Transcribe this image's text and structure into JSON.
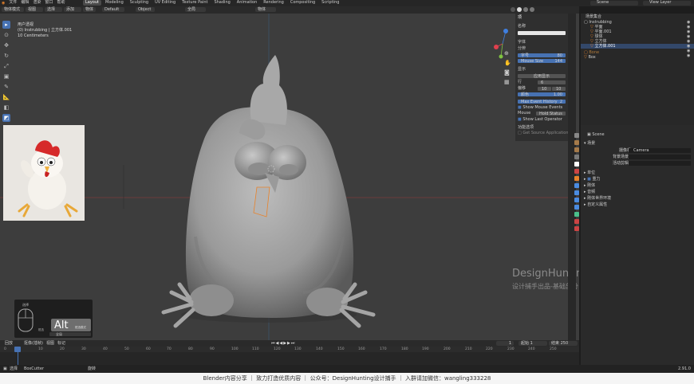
{
  "topbar": {
    "menu": [
      "文件",
      "编辑",
      "渲染",
      "窗口",
      "帮助"
    ],
    "workspaces": [
      "Layout",
      "Modeling",
      "Sculpting",
      "UV Editing",
      "Texture Paint",
      "Shading",
      "Animation",
      "Rendering",
      "Compositing",
      "Scripting"
    ],
    "active_workspace": "Layout",
    "scene": "Scene",
    "view_layer": "View Layer"
  },
  "viewport_header": {
    "mode": "物体模式",
    "view": "视图",
    "select": "选择",
    "add": "添加",
    "object": "物体",
    "orientation": "全局",
    "pivot": "Default",
    "drag": "Object",
    "snap": "全局",
    "shading": "物体"
  },
  "viewport": {
    "view_name": "用户透视",
    "collection_info": "(0) Instrubbing | 立方体.001",
    "subinfo": "10 Centimeters",
    "watermark_title": "DesignHunting",
    "watermark_sub": "设计捕手出品-基础部分",
    "alt_key": "Alt",
    "keypanel_items": [
      "选择",
      "框选模式",
      "框选"
    ],
    "keypanel_dropdown": "全局"
  },
  "npanel": {
    "tab": "项",
    "name_label": "名称",
    "rows": [
      {
        "label": "字体",
        "value": ""
      },
      {
        "label": "分辨",
        "value": ""
      },
      {
        "label": "字号",
        "value": "80"
      },
      {
        "label": "Mouse Size",
        "value": "144"
      }
    ],
    "section_label": "显示",
    "apply_button": "应用显示",
    "lines_label": "行",
    "lines_value": "6",
    "offset_label": "偏移",
    "offset_x": "10",
    "offset_y": "10",
    "color_label": "颜色",
    "color_value": "1.00",
    "history": "Max Event History",
    "history_value": "2",
    "mouse_events": "Show Mouse Events",
    "mouse_label": "Mouse",
    "mouse_value": "Hold Status",
    "last_op": "Show Last Operator",
    "extra_label": "功能选项",
    "extra_item": "Get Source Application"
  },
  "outliner": {
    "title": "场景集合",
    "items": [
      {
        "label": "Instrubbing",
        "depth": 0,
        "selected": false
      },
      {
        "label": "平面",
        "depth": 1,
        "selected": false
      },
      {
        "label": "平面.001",
        "depth": 1,
        "selected": false
      },
      {
        "label": "球体",
        "depth": 1,
        "selected": false
      },
      {
        "label": "立方体",
        "depth": 1,
        "selected": false
      },
      {
        "label": "立方体.001",
        "depth": 1,
        "selected": true
      },
      {
        "label": "Bone",
        "depth": 0,
        "selected": false
      },
      {
        "label": "Box",
        "depth": 0,
        "selected": false
      }
    ]
  },
  "properties": {
    "object": "Scene",
    "section_scene": "场景",
    "camera_label": "摄像机",
    "camera_value": "Camera",
    "bg_label": "背景场景",
    "clip_label": "活动剪辑",
    "sections": [
      "单位",
      "重力",
      "刚体",
      "音频",
      "刚体世界环境",
      "自定义属性"
    ]
  },
  "timeline": {
    "menu": [
      "回放",
      "抠像(插帧)",
      "视图",
      "标记"
    ],
    "current_frame": "1",
    "start_label": "起始",
    "start": "1",
    "end_label": "结束",
    "end": "250",
    "ticks": [
      "0",
      "10",
      "20",
      "30",
      "40",
      "50",
      "60",
      "70",
      "80",
      "90",
      "100",
      "110",
      "120",
      "130",
      "140",
      "150",
      "160",
      "170",
      "180",
      "190",
      "200",
      "210",
      "220",
      "230",
      "240",
      "250"
    ]
  },
  "statusbar": {
    "left": "选择",
    "mid": "BoxCutter",
    "right": "旋转",
    "version": "2.91.0"
  },
  "footer": {
    "text": "Blender内容分享  ｜  致力打造优质内容  ｜  公众号：DesignHunting设计捕手  ｜  入群请加微信：wangling333228"
  },
  "colors": {
    "accent": "#4772b3",
    "gizmo_x": "#e0404e",
    "gizmo_y": "#7fc241",
    "gizmo_z": "#3f7fe0",
    "selection": "#e8822a"
  }
}
